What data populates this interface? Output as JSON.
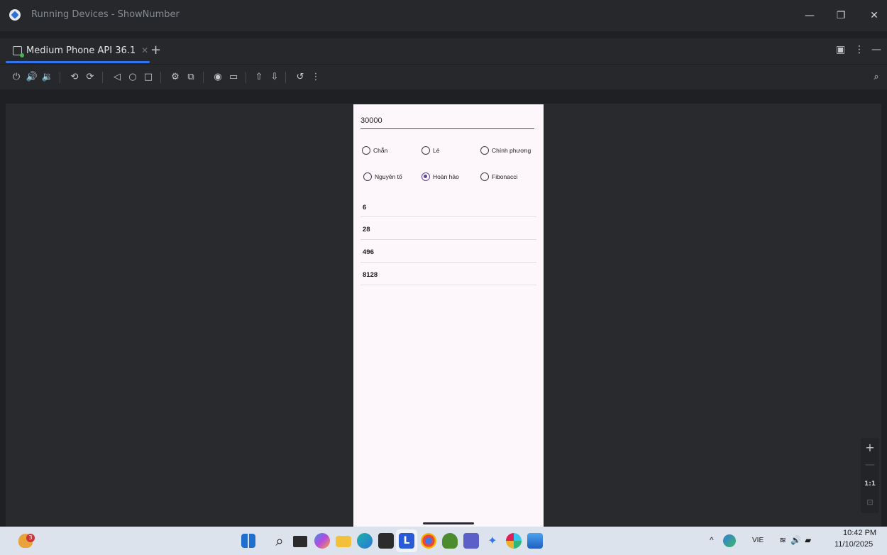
{
  "window": {
    "title": "Running Devices - ShowNumber"
  },
  "tabs": [
    {
      "label": "Medium Phone API 36.1"
    }
  ],
  "phone": {
    "input_value": "30000",
    "radios": [
      {
        "label": "Chẵn",
        "checked": false
      },
      {
        "label": "Lẻ",
        "checked": false
      },
      {
        "label": "Chính phương",
        "checked": false
      },
      {
        "label": "Nguyên tố",
        "checked": false
      },
      {
        "label": "Hoàn hảo",
        "checked": true
      },
      {
        "label": "Fibonacci",
        "checked": false
      }
    ],
    "results": [
      "6",
      "28",
      "496",
      "8128"
    ]
  },
  "zoom": {
    "actual_size_label": "1:1"
  },
  "taskbar": {
    "notification_count": "3",
    "language": "VIE",
    "time": "10:42 PM",
    "date": "11/10/2025",
    "app_l_label": "L"
  },
  "colors": {
    "accent": "#3574f0",
    "radio_checked": "#5b4b96"
  }
}
